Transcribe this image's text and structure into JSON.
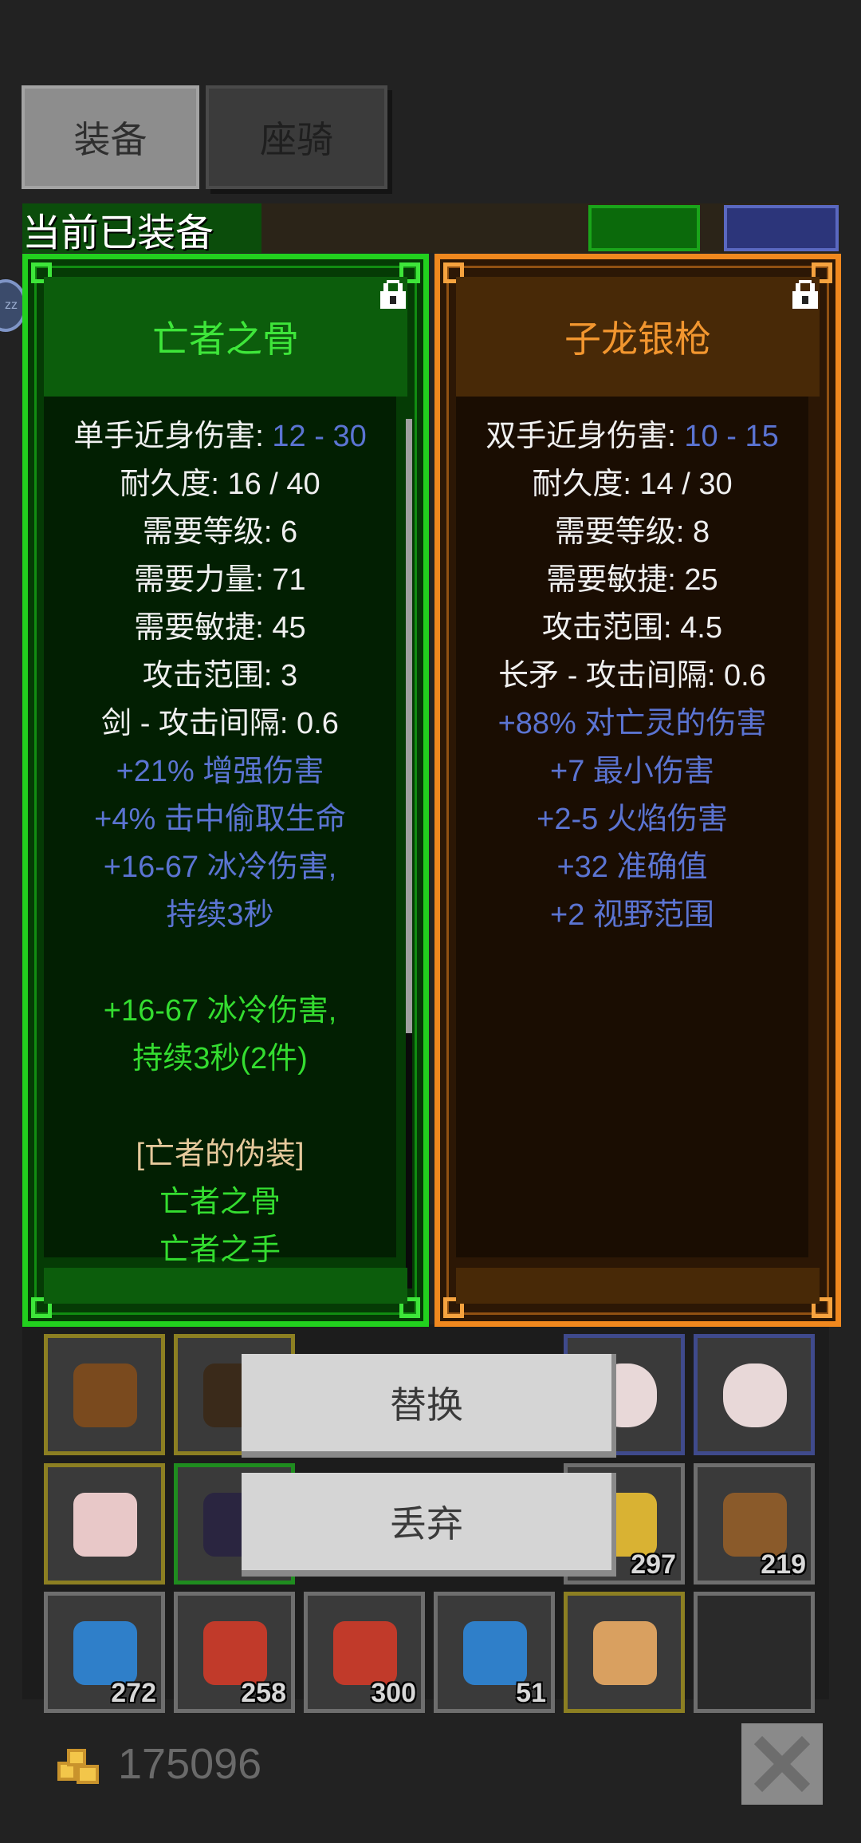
{
  "tabs": [
    {
      "label": "装备",
      "active": true
    },
    {
      "label": "座骑",
      "active": false
    }
  ],
  "section_label": "当前已装备",
  "side_bubble_text": "zz",
  "items": {
    "left": {
      "name": "亡者之骨",
      "rarity_color": "#22d11e",
      "lines": [
        {
          "label": "单手近身伤害: ",
          "value": "12 - 30",
          "style": "white-blue"
        },
        {
          "text": "耐久度: 16 / 40",
          "style": "white"
        },
        {
          "text": "需要等级: 6",
          "style": "white"
        },
        {
          "text": "需要力量: 71",
          "style": "white"
        },
        {
          "text": "需要敏捷: 45",
          "style": "white"
        },
        {
          "text": "攻击范围: 3",
          "style": "white"
        },
        {
          "text": "剑 - 攻击间隔: 0.6",
          "style": "white"
        },
        {
          "text": "+21% 增强伤害",
          "style": "blue"
        },
        {
          "text": "+4% 击中偷取生命",
          "style": "blue"
        },
        {
          "text": "+16-67 冰冷伤害,",
          "style": "blue"
        },
        {
          "text": "持续3秒",
          "style": "blue"
        },
        {
          "text": "",
          "style": "gap"
        },
        {
          "text": "+16-67 冰冷伤害,",
          "style": "green"
        },
        {
          "text": "持续3秒(2件)",
          "style": "green"
        },
        {
          "text": "",
          "style": "gap"
        },
        {
          "text": "[亡者的伪装]",
          "style": "gold"
        },
        {
          "text": "亡者之骨",
          "style": "green"
        },
        {
          "text": "亡者之手",
          "style": "green"
        }
      ]
    },
    "right": {
      "name": "子龙银枪",
      "rarity_color": "#f0881e",
      "lines": [
        {
          "label": "双手近身伤害: ",
          "value": "10 - 15",
          "style": "white-blue"
        },
        {
          "text": "耐久度: 14 / 30",
          "style": "white"
        },
        {
          "text": "需要等级: 8",
          "style": "white"
        },
        {
          "text": "需要敏捷: 25",
          "style": "white"
        },
        {
          "text": "攻击范围: 4.5",
          "style": "white"
        },
        {
          "text": "长矛 - 攻击间隔: 0.6",
          "style": "white"
        },
        {
          "text": "+88% 对亡灵的伤害",
          "style": "blue"
        },
        {
          "text": "+7 最小伤害",
          "style": "blue"
        },
        {
          "text": "+2-5 火焰伤害",
          "style": "blue"
        },
        {
          "text": "+32 准确值",
          "style": "blue"
        },
        {
          "text": "+2 视野范围",
          "style": "blue"
        }
      ]
    }
  },
  "actions": {
    "replace": "替换",
    "discard": "丢弃"
  },
  "inventory": [
    {
      "icon": "shield-icon",
      "count": "",
      "frame": "#8c7f22"
    },
    {
      "icon": "armor-icon",
      "count": "",
      "frame": "#8c7f22"
    },
    {
      "icon": "egg-icon",
      "count": "",
      "frame": "#3f4a8c"
    },
    {
      "icon": "egg-icon",
      "count": "",
      "frame": "#3f4a8c"
    },
    {
      "icon": "pig-pet-icon",
      "count": "",
      "frame": "#8c7f22"
    },
    {
      "icon": "dark-ore-icon",
      "count": "",
      "frame": "#1f8c1f"
    },
    {
      "icon": "gold-nugget-icon",
      "count": "297",
      "frame": "#6e6e6e"
    },
    {
      "icon": "bread-icon",
      "count": "219",
      "frame": "#6e6e6e"
    },
    {
      "icon": "blue-feather-icon",
      "count": "272",
      "frame": "#6e6e6e"
    },
    {
      "icon": "red-feather-icon",
      "count": "258",
      "frame": "#6e6e6e"
    },
    {
      "icon": "red-feather-icon",
      "count": "300",
      "frame": "#6e6e6e"
    },
    {
      "icon": "blue-feather-icon",
      "count": "51",
      "frame": "#6e6e6e"
    },
    {
      "icon": "cat-pet-icon",
      "count": "",
      "frame": "#8c7f22"
    },
    {
      "icon": "empty-slot",
      "count": "",
      "frame": "#6e6e6e"
    }
  ],
  "gold": "175096"
}
